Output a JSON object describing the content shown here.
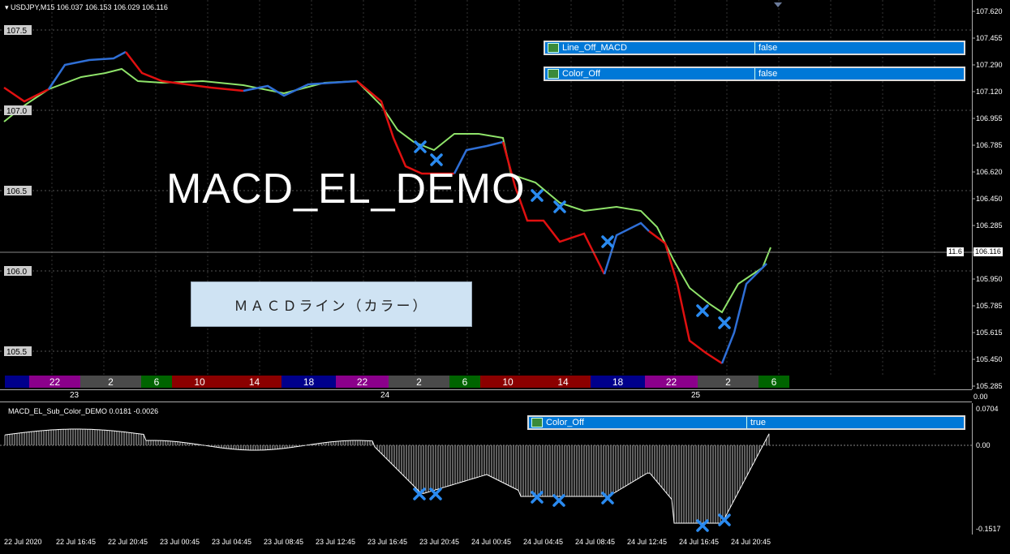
{
  "header": {
    "symbol": "USDJPY,M15",
    "ohlc": "106.037 106.153 106.029 106.116",
    "sub_indicator": "MACD_EL_Sub_Color_DEMO 0.0181 -0.0026"
  },
  "overlay": {
    "title": "MACD_EL_DEMO",
    "note": "ＭＡＣＤライン（カラー）"
  },
  "params_main": [
    {
      "name": "Line_Off_MACD",
      "value": "false"
    },
    {
      "name": "Color_Off",
      "value": "false"
    }
  ],
  "params_sub": [
    {
      "name": "Color_Off",
      "value": "true"
    }
  ],
  "price_axis": [
    "107.620",
    "107.455",
    "107.290",
    "107.120",
    "106.955",
    "106.785",
    "106.620",
    "106.450",
    "106.285",
    "106.116",
    "105.950",
    "105.785",
    "105.615",
    "105.450",
    "105.285"
  ],
  "left_price_labels": [
    "107.5",
    "107.0",
    "106.5",
    "106.0",
    "105.5"
  ],
  "current_price": "106.116",
  "current_tag": "11.6",
  "session_bars": [
    {
      "label": "",
      "color": "#00008b"
    },
    {
      "label": "22",
      "color": "#8b008b"
    },
    {
      "label": "2",
      "color": "#4a4a4a"
    },
    {
      "label": "6",
      "color": "#006400"
    },
    {
      "label": "10",
      "color": "#8b0000"
    },
    {
      "label": "14",
      "color": "#8b0000"
    },
    {
      "label": "18",
      "color": "#00008b"
    },
    {
      "label": "22",
      "color": "#8b008b"
    },
    {
      "label": "2",
      "color": "#4a4a4a"
    },
    {
      "label": "6",
      "color": "#006400"
    },
    {
      "label": "10",
      "color": "#8b0000"
    },
    {
      "label": "14",
      "color": "#8b0000"
    },
    {
      "label": "18",
      "color": "#00008b"
    },
    {
      "label": "22",
      "color": "#8b008b"
    },
    {
      "label": "2",
      "color": "#4a4a4a"
    },
    {
      "label": "6",
      "color": "#006400"
    }
  ],
  "day_labels": [
    "23",
    "24",
    "25"
  ],
  "corner_label": "0.00",
  "sub_axis": [
    "0.0704",
    "0.00",
    "-0.1517"
  ],
  "time_axis": [
    "22 Jul 2020",
    "22 Jul 16:45",
    "22 Jul 20:45",
    "23 Jul 00:45",
    "23 Jul 04:45",
    "23 Jul 08:45",
    "23 Jul 12:45",
    "23 Jul 16:45",
    "23 Jul 20:45",
    "24 Jul 00:45",
    "24 Jul 04:45",
    "24 Jul 08:45",
    "24 Jul 12:45",
    "24 Jul 16:45",
    "24 Jul 20:45"
  ],
  "colors": {
    "macd_up": "#2f6fd6",
    "macd_down": "#e01010",
    "price": "#8fe36a",
    "cross": "#2a8af0",
    "panel_blue": "#0078d7"
  }
}
